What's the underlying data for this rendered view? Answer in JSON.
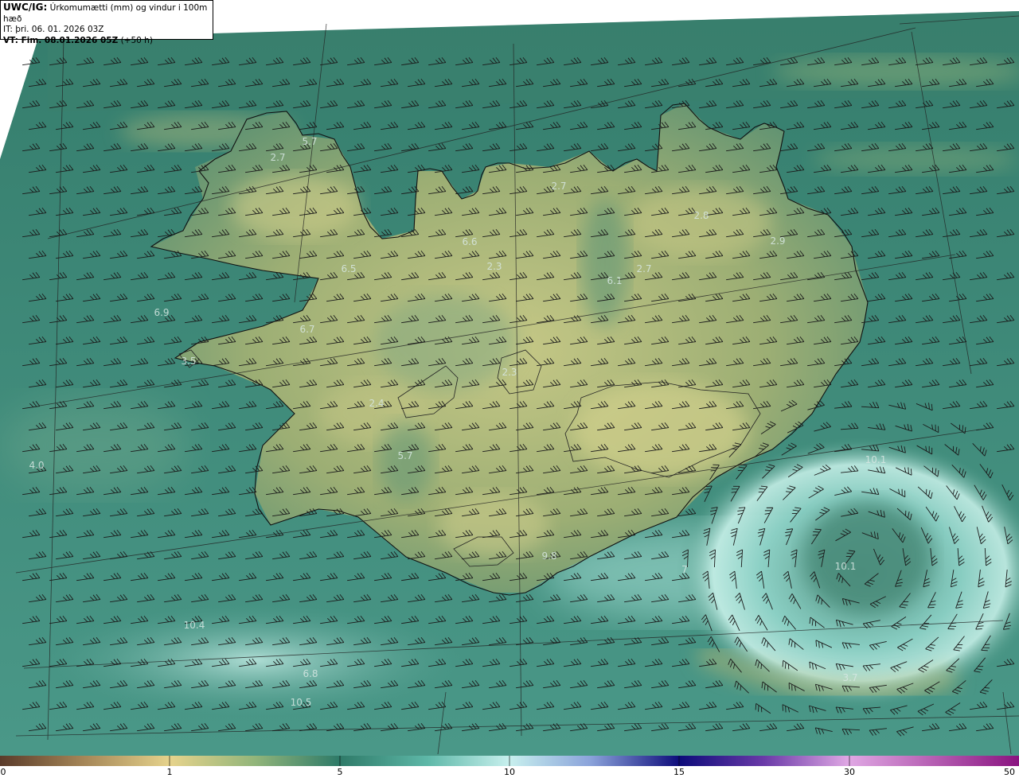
{
  "header": {
    "product_bold": "UWC/IG:",
    "product_rest": " Úrkomumætti (mm) og vindur i 100m hæð",
    "init_time": "IT: þri. 06. 01. 2026 03Z",
    "valid_bold": "VT: Fim. 08.01.2026 05Z",
    "valid_rest": " (+50 h)"
  },
  "colors": {
    "background_sea": "#3f8c7c",
    "land_low": "#5a8a6a",
    "land_high": "#c8cc86",
    "high_precip": "#b9e6de",
    "barbs": "#1a1a1a"
  },
  "value_labels": [
    "5.7",
    "2.7",
    "2.7",
    "2.8",
    "2.9",
    "6.6",
    "2.3",
    "6.1",
    "2.7",
    "6.5",
    "6.9",
    "6.7",
    "3.5",
    "2.3",
    "2.4",
    "5.7",
    "4.0",
    "10.1",
    "9.8",
    "7",
    "10.1",
    "10.4",
    "6.8",
    "10.5",
    "3.7"
  ],
  "colorbar": {
    "ticks": [
      "0",
      "1",
      "5",
      "10",
      "15",
      "30",
      "50"
    ]
  }
}
